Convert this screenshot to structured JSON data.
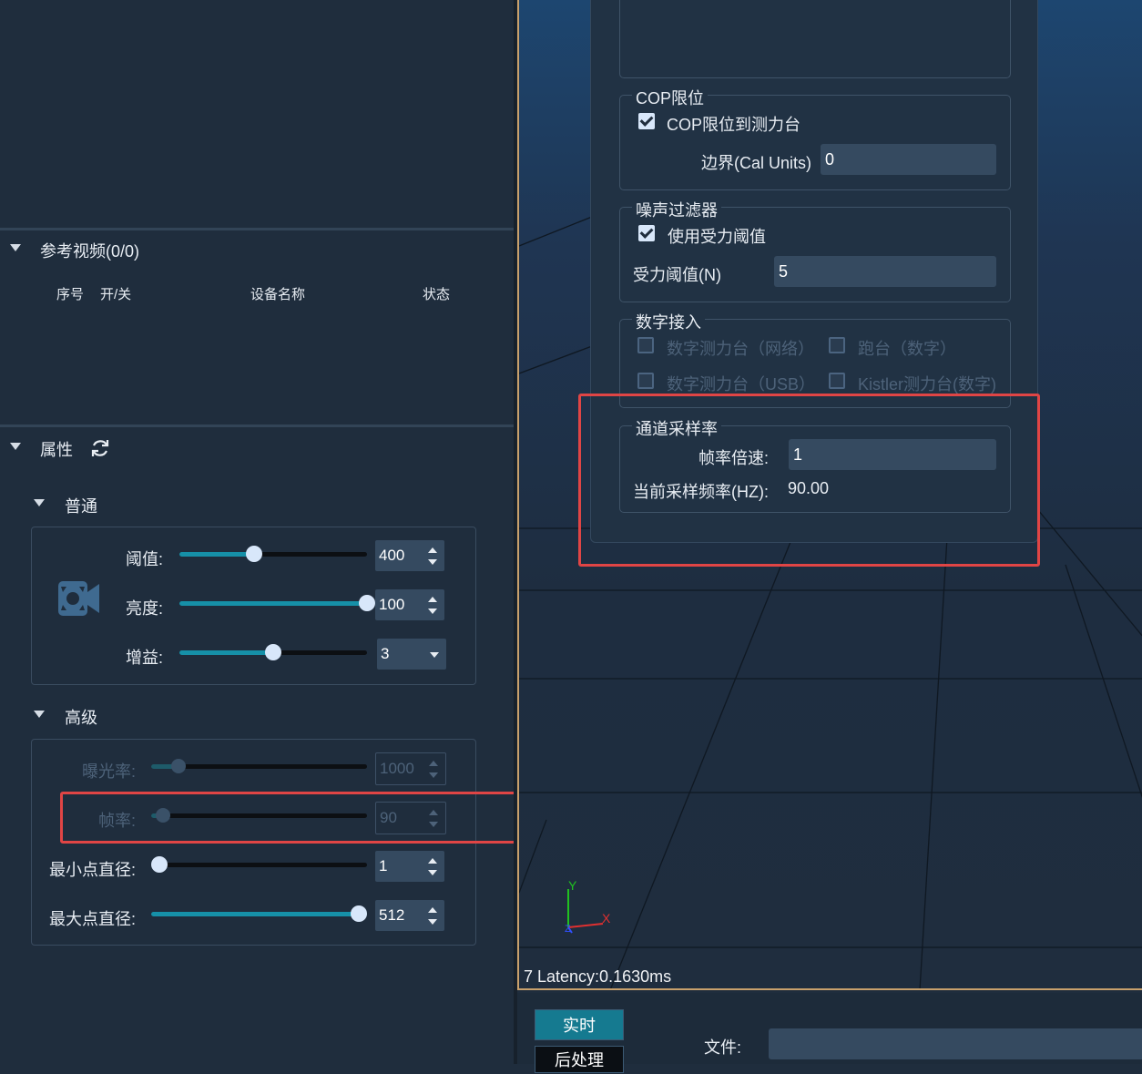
{
  "left": {
    "ref_video": {
      "title": "参考视频(0/0)",
      "columns": [
        "序号",
        "开/关",
        "设备名称",
        "状态"
      ]
    },
    "properties": {
      "title": "属性",
      "normal": {
        "title": "普通",
        "threshold": {
          "label": "阈值:",
          "value": "400",
          "fraction": 0.4
        },
        "brightness": {
          "label": "亮度:",
          "value": "100",
          "fraction": 1.0
        },
        "gain": {
          "label": "增益:",
          "value": "3",
          "fraction": 0.5
        }
      },
      "advanced": {
        "title": "高级",
        "exposure": {
          "label": "曝光率:",
          "value": "1000",
          "fraction": 0.13
        },
        "frame_rate": {
          "label": "帧率:",
          "value": "90",
          "fraction": 0.06
        },
        "min_dot": {
          "label": "最小点直径:",
          "value": "1",
          "fraction": 0.0
        },
        "max_dot": {
          "label": "最大点直径:",
          "value": "512",
          "fraction": 1.0
        }
      }
    }
  },
  "dialog": {
    "cop_limit": {
      "title": "COP限位",
      "checkbox_label": "COP限位到测力台",
      "checked": true,
      "border_label": "边界(Cal Units)",
      "border_value": "0"
    },
    "noise_filter": {
      "title": "噪声过滤器",
      "checkbox_label": "使用受力阈值",
      "checked": true,
      "threshold_label": "受力阈值(N)",
      "threshold_value": "5"
    },
    "digital_input": {
      "title": "数字接入",
      "options": [
        "数字测力台（网络）",
        "跑台（数字）",
        "数字测力台（USB）",
        "Kistler测力台(数字)"
      ]
    },
    "channel_rate": {
      "title": "通道采样率",
      "multiplier_label": "帧率倍速:",
      "multiplier_value": "1",
      "current_rate_label": "当前采样频率(HZ):",
      "current_rate_value": "90.00"
    }
  },
  "viewport": {
    "latency_text": "7 Latency:0.1630ms",
    "axis_x": "X",
    "axis_y": "Y",
    "axis_z": "Z"
  },
  "bottom": {
    "realtime_label": "实时",
    "postprocess_label": "后处理",
    "file_label": "文件:",
    "file_value": ""
  },
  "colors": {
    "background": "#1f2d3d",
    "accent": "#1690a8",
    "highlight": "#e04545",
    "border_gold": "#c8a06c"
  }
}
